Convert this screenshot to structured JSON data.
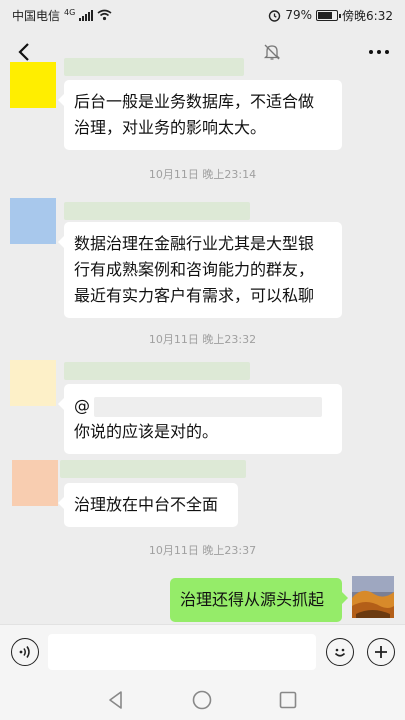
{
  "status_bar": {
    "carrier": "中国电信",
    "network": "4G",
    "battery": "79%",
    "battery_level": 0.79,
    "time": "傍晚6:32",
    "icons": [
      "signal-icon",
      "wifi-icon",
      "alarm-icon",
      "battery-icon"
    ]
  },
  "header": {
    "icons": [
      "back-icon",
      "mute-icon",
      "more-icon"
    ]
  },
  "messages": [
    {
      "text": "后台一般是业务数据库，不适合做治理，对业务的影响太大。",
      "line1": "后台一般是业务数据库，不适合做",
      "line2": "治理，对业务的影响太大。",
      "avatar_color": "#ffee00"
    },
    {
      "line1": "数据治理在金融行业尤其是大型银",
      "line2": "行有成熟案例和咨询能力的群友，",
      "line3": "最近有实力客户有需求，可以私聊",
      "avatar_color": "#a8c8ec"
    },
    {
      "mention": "@",
      "line1": "你说的应该是对的。",
      "avatar_color": "#fdf0c8"
    },
    {
      "line1": "治理放在中台不全面",
      "avatar_color": "#f8cdb0"
    },
    {
      "line1": "治理还得从源头抓起",
      "mine": true
    }
  ],
  "timestamps": [
    "10月11日 晚上23:14",
    "10月11日 晚上23:32",
    "10月11日 晚上23:37"
  ],
  "input": {
    "value": "",
    "placeholder": ""
  },
  "toolbar_icons": [
    "voice-icon",
    "emoji-icon",
    "add-icon"
  ],
  "nav_icons": [
    "nav-back-icon",
    "nav-home-icon",
    "nav-recent-icon"
  ]
}
